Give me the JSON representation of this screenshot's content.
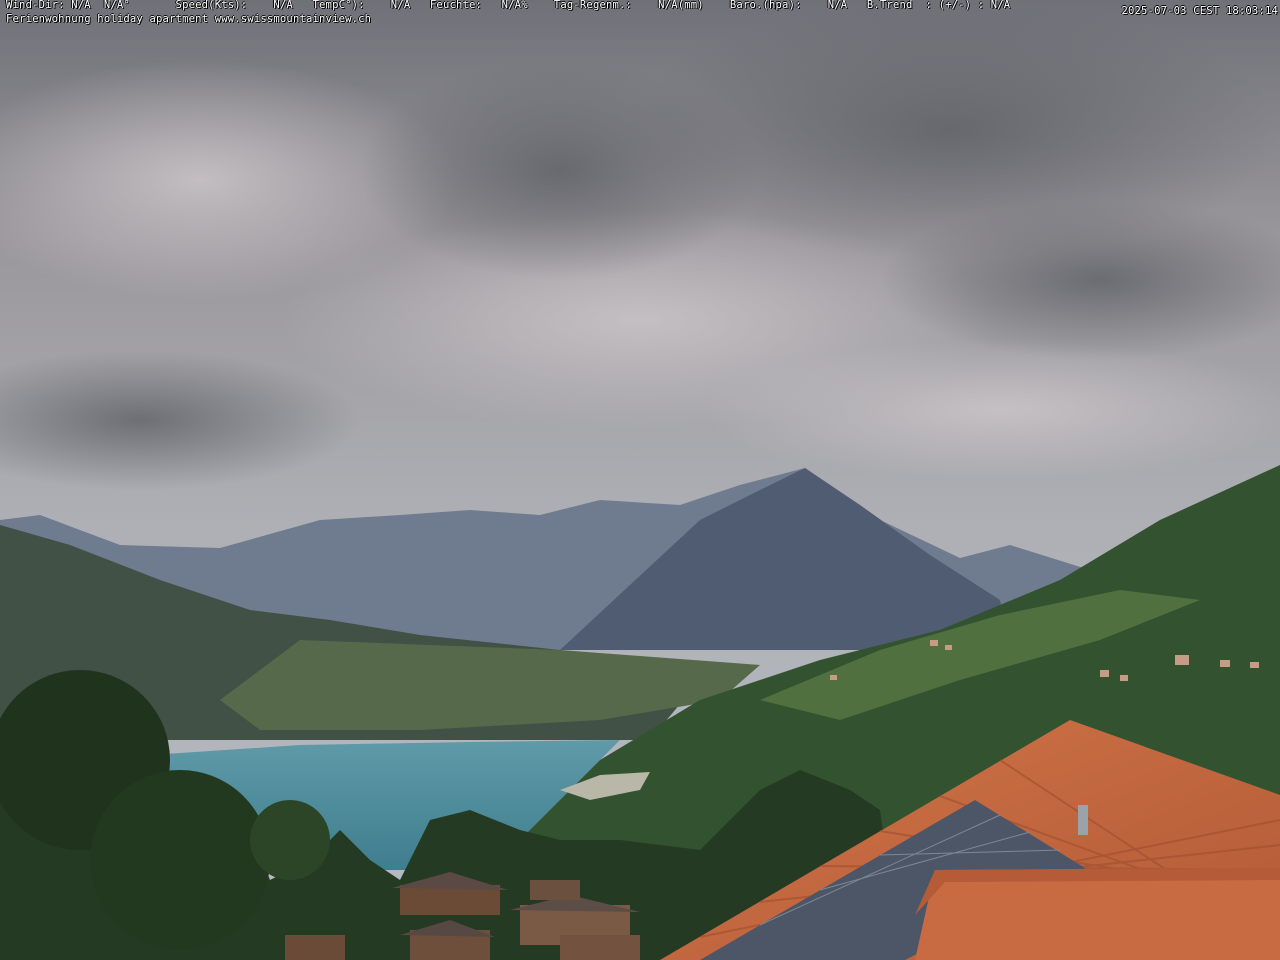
{
  "overlay": {
    "weather_line": "Wind-Dir: N/A  N/A°       Speed(Kts):    N/A   TempC°):    N/A   Feuchte:   N/A%    Tag-Regenm.:    N/A(mm)    Baro.(hpa):    N/A   B.Trend  : (+/-) : N/A",
    "caption": "Ferienwohnung holiday apartment www.swissmountainview.ch",
    "timestamp": "2025-07-03 CEST 18:03:14"
  },
  "colors": {
    "sky_top": "#77797f",
    "sky_mid": "#a6a4a8",
    "sky_low": "#b8bcc2",
    "mountain_far": "#6e7b8e",
    "mountain_near": "#4f5d72",
    "lake": "#4f8fa0",
    "forest": "#2e4a2a",
    "roof": "#c8673f",
    "solar": "#4d5666"
  }
}
